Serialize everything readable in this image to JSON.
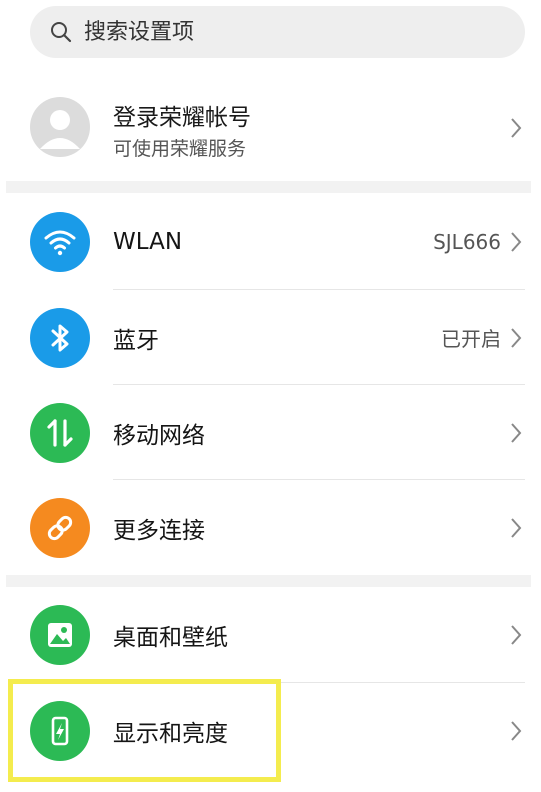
{
  "search": {
    "placeholder": "搜索设置项"
  },
  "account": {
    "title": "登录荣耀帐号",
    "subtitle": "可使用荣耀服务"
  },
  "groups": {
    "network": [
      {
        "label": "WLAN",
        "value": "SJL666",
        "icon": "wifi-icon",
        "color": "#1a9be8"
      },
      {
        "label": "蓝牙",
        "value": "已开启",
        "icon": "bluetooth-icon",
        "color": "#1a9be8"
      },
      {
        "label": "移动网络",
        "value": "",
        "icon": "mobile-data-icon",
        "color": "#2cba55"
      },
      {
        "label": "更多连接",
        "value": "",
        "icon": "link-icon",
        "color": "#f58a1f"
      }
    ],
    "display": [
      {
        "label": "桌面和壁纸",
        "value": "",
        "icon": "wallpaper-icon",
        "color": "#2cba55"
      },
      {
        "label": "显示和亮度",
        "value": "",
        "icon": "display-brightness-icon",
        "color": "#2cba55"
      }
    ]
  },
  "highlight_color": "#f4ec4e"
}
